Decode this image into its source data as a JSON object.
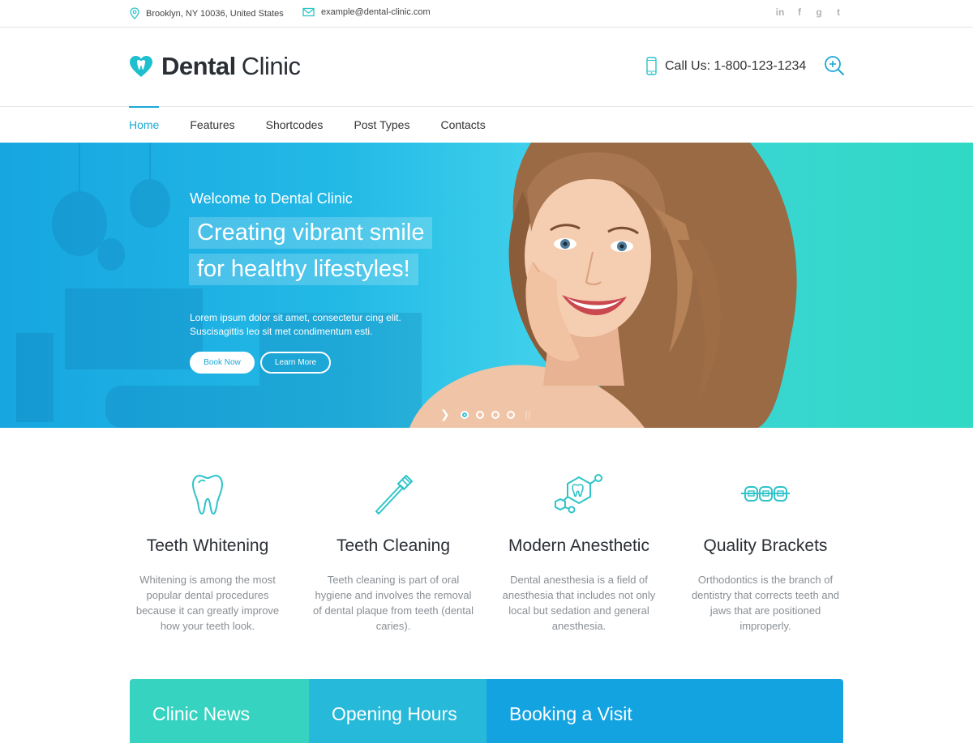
{
  "topbar": {
    "address": "Brooklyn, NY 10036, United States",
    "email": "example@dental-clinic.com",
    "socials": [
      {
        "icon": "linkedin-icon",
        "glyph": "in"
      },
      {
        "icon": "facebook-icon",
        "glyph": "f"
      },
      {
        "icon": "google-plus-icon",
        "glyph": "g"
      },
      {
        "icon": "twitter-icon",
        "glyph": "t"
      }
    ]
  },
  "header": {
    "logo_bold": "Dental",
    "logo_light": "Clinic",
    "call_us": "Call Us: 1-800-123-1234"
  },
  "nav": {
    "items": [
      "Home",
      "Features",
      "Shortcodes",
      "Post Types",
      "Contacts"
    ],
    "active": "Home"
  },
  "hero": {
    "welcome": "Welcome to Dental Clinic",
    "tagline_line1": "Creating vibrant smile",
    "tagline_line2": "for healthy lifestyles!",
    "description_line1": "Lorem ipsum dolor sit amet, consectetur cing elit.",
    "description_line2": "Suscisagittis leo sit met condimentum esti.",
    "book_now": "Book Now",
    "learn_more": "Learn More",
    "slides_count": 4,
    "active_slide": 1
  },
  "features": [
    {
      "icon": "tooth-icon",
      "title": "Teeth Whitening",
      "text": "Whitening is among the most popular dental procedures because it can greatly improve how your teeth look."
    },
    {
      "icon": "toothbrush-icon",
      "title": "Teeth Cleaning",
      "text": "Teeth cleaning is part of oral hygiene and involves the removal of dental plaque from teeth (dental caries)."
    },
    {
      "icon": "molecule-tooth-icon",
      "title": "Modern Anesthetic",
      "text": "Dental anesthesia is a field of anesthesia that includes not only local but sedation and general anesthesia."
    },
    {
      "icon": "braces-icon",
      "title": "Quality Brackets",
      "text": "Orthodontics is the branch of dentistry that corrects teeth and jaws that are positioned improperly."
    }
  ],
  "panels": {
    "news": "Clinic News",
    "hours": "Opening Hours",
    "booking": "Booking a Visit"
  },
  "colors": {
    "accent": "#1ba9d6",
    "teal": "#36d3c0",
    "cyan": "#26b9d9",
    "blue": "#13a3e1"
  }
}
